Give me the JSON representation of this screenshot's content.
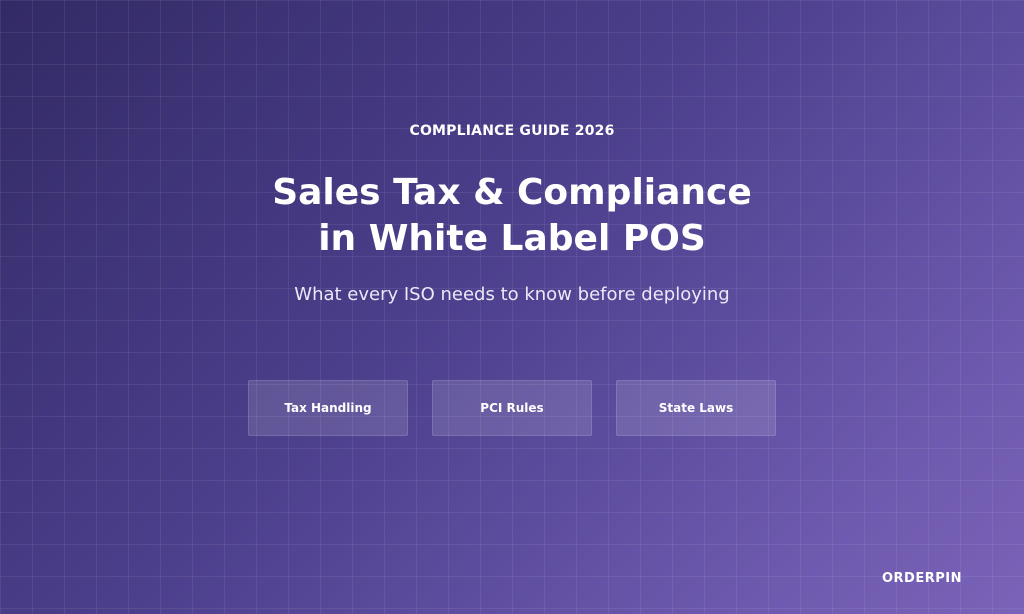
{
  "banner": {
    "eyebrow": "COMPLIANCE GUIDE 2026",
    "title_line1": "Sales Tax & Compliance",
    "title_line2": "in White Label POS",
    "subtitle": "What every ISO needs to know before deploying",
    "tags": [
      {
        "label": "Tax Handling"
      },
      {
        "label": "PCI Rules"
      },
      {
        "label": "State Laws"
      }
    ],
    "brand": "ORDERPIN"
  },
  "colors": {
    "gradient_start": "#322a66",
    "gradient_end": "#7a63b8",
    "text": "#ffffff"
  }
}
